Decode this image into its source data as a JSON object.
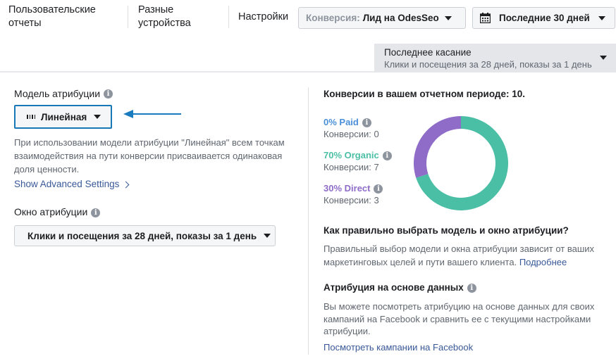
{
  "nav": {
    "custom_reports": [
      "Пользовательские",
      "отчеты"
    ],
    "devices": [
      "Разные",
      "устройства"
    ],
    "settings": "Настройки"
  },
  "conversion_filter": {
    "label": "Конверсия:",
    "value": "Лид на OdesSeo"
  },
  "date_range": {
    "value": "Последние 30 дней",
    "icon": "calendar-icon"
  },
  "touch": {
    "title": "Последнее касание",
    "subtitle": "Клики и посещения за 28 дней, показы за 1 день"
  },
  "attribution_model": {
    "label": "Модель атрибуции",
    "selected": "Линейная",
    "description": "При использовании модели атрибуции \"Линейная\" всем точкам взаимодействия на пути конверсии присваивается одинаковая доля ценности.",
    "advanced_link": "Show Advanced Settings"
  },
  "attribution_window": {
    "label": "Окно атрибуции",
    "selected": "Клики и посещения за 28 дней, показы за 1 день"
  },
  "summary": {
    "title": "Конверсии в вашем отчетном периоде: 10."
  },
  "legend": [
    {
      "name": "0% Paid",
      "value": "Конверсии: 0",
      "color": "#4a90d9"
    },
    {
      "name": "70% Organic",
      "value": "Конверсии: 7",
      "color": "#4bbfa5"
    },
    {
      "name": "30% Direct",
      "value": "Конверсии: 3",
      "color": "#8e6cc8"
    }
  ],
  "chart_data": {
    "type": "pie",
    "categories": [
      "Paid",
      "Organic",
      "Direct"
    ],
    "values": [
      0,
      7,
      3
    ],
    "colors": [
      "#4a90d9",
      "#4bbfa5",
      "#8e6cc8"
    ]
  },
  "how_to": {
    "title": "Как правильно выбрать модель и окно атрибуции?",
    "text": "Правильный выбор модели и окна атрибуции зависит от ваших маркетинговых целей и пути вашего клиента.",
    "link": "Подробнее"
  },
  "data_driven": {
    "title": "Атрибуция на основе данных",
    "text": "Вы можете посмотреть атрибуцию на основе данных для своих кампаний на Facebook и сравнить ее с текущими настройками атрибуции.",
    "link": "Посмотреть кампании на Facebook"
  }
}
